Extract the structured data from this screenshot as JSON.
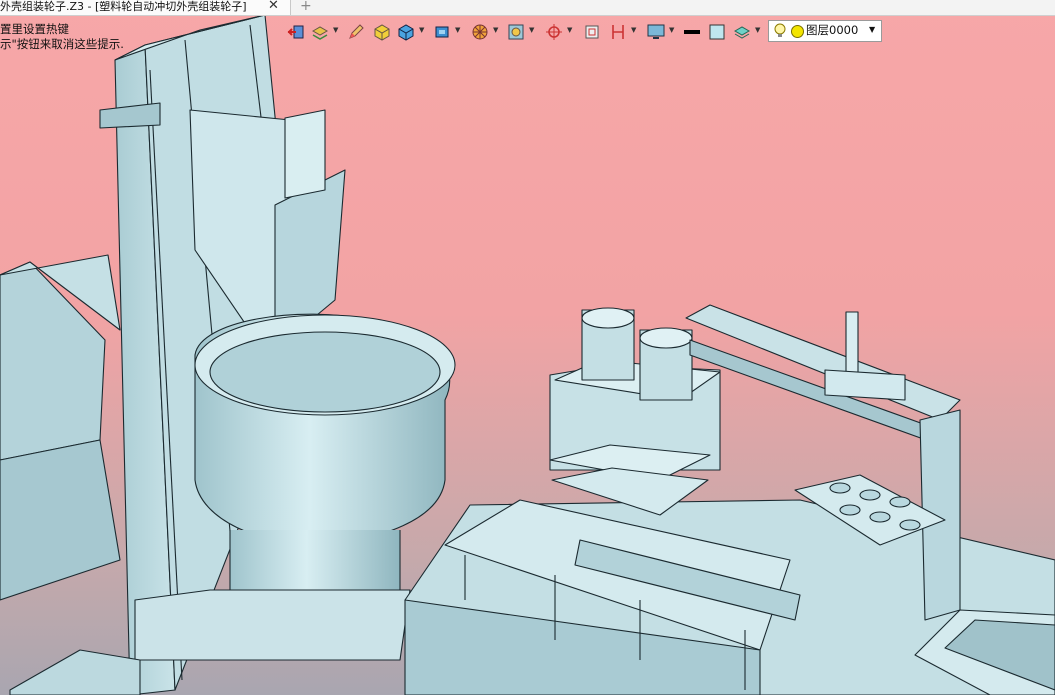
{
  "window": {
    "tab_title": "外壳组装轮子.Z3 - [塑料轮自动冲切外壳组装轮子]",
    "close_glyph": "✕",
    "new_tab_glyph": "+"
  },
  "hint": {
    "line1": "置里设置热键",
    "line2": "示\"按钮来取消这些提示."
  },
  "toolbar": {
    "icons": [
      "exit-icon",
      "layers-stack-icon",
      "pencil-icon",
      "box-yellow-icon",
      "cube-icon",
      "cube-dropdown-icon",
      "wheel-icon",
      "frame-icon",
      "origin-icon",
      "square-icon",
      "bracket-icon",
      "monitor-icon",
      "line-color-icon",
      "fill-color-icon",
      "stack-icon"
    ],
    "colors": {
      "line": "#000000",
      "fill": "#bfe6ef"
    }
  },
  "layer": {
    "label": "图层0000",
    "dropdown_glyph": "▼"
  },
  "viewport": {
    "background_top": "#f7a7a8",
    "background_bottom": "#a9a6b0",
    "model_color": "#b9d8df",
    "edge_color": "#1b2a30"
  }
}
